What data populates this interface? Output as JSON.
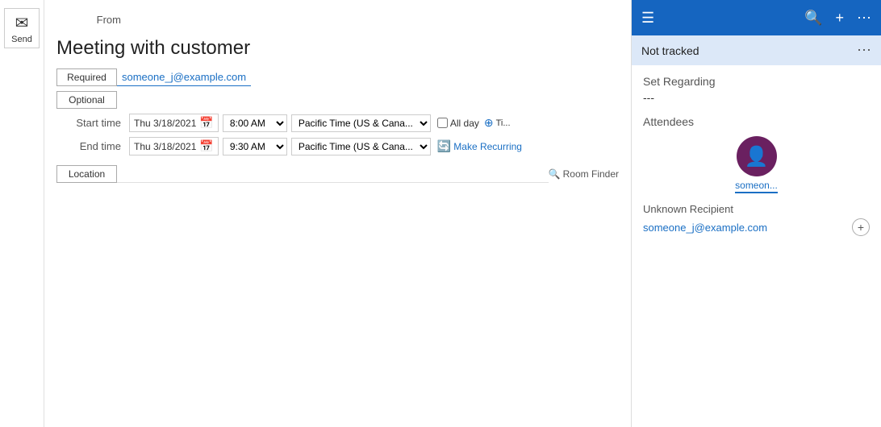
{
  "send_panel": {
    "send_label": "Send",
    "send_icon": "✈"
  },
  "compose": {
    "from_label": "From",
    "title": "Meeting with customer",
    "required_label": "Required",
    "optional_label": "Optional",
    "required_email": "someone_j@example.com",
    "optional_placeholder": "",
    "start_time_label": "Start time",
    "end_time_label": "End time",
    "start_date": "Thu 3/18/2021",
    "end_date": "Thu 3/18/2021",
    "start_time": "8:00 AM",
    "end_time": "9:30 AM",
    "timezone": "Pacific Time (US & Cana...",
    "allday_label": "All day",
    "recurring_label": "Make Recurring",
    "location_label": "Location",
    "room_finder_label": "Room Finder"
  },
  "right_panel": {
    "menu_icon": "☰",
    "search_icon": "🔍",
    "add_icon": "+",
    "more_icon": "⋯",
    "not_tracked_label": "Not tracked",
    "set_regarding_label": "Set Regarding",
    "regarding_value": "---",
    "attendees_label": "Attendees",
    "attendee_name": "someon...",
    "unknown_recipient_label": "Unknown Recipient",
    "unknown_email": "someone_j@example.com",
    "add_label": "+"
  }
}
